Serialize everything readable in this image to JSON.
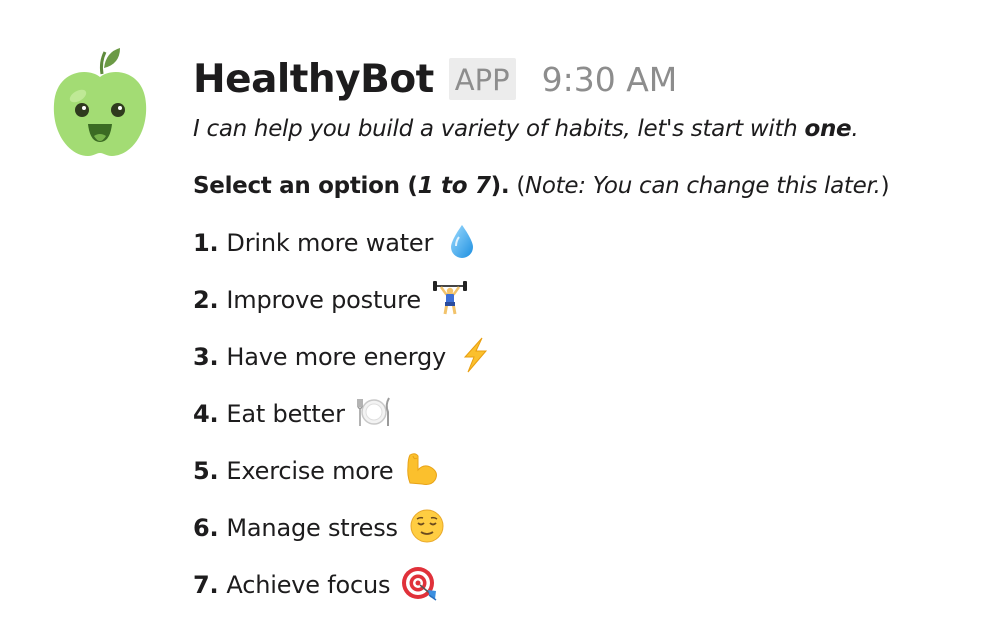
{
  "message": {
    "bot_name": "HealthyBot",
    "badge": "APP",
    "timestamp": "9:30 AM",
    "intro": {
      "before": "I can help you build a variety of habits, let's start with ",
      "bold": "one",
      "after": "."
    },
    "select": {
      "bold_a": "Select an option (",
      "bold_italic": "1 to 7",
      "bold_b": ").",
      "normal_a": " (",
      "italic": "Note: You can change this later.",
      "normal_b": ")"
    },
    "options": [
      {
        "num": "1.",
        "label": "Drink more water",
        "icon": "droplet-icon"
      },
      {
        "num": "2.",
        "label": "Improve posture",
        "icon": "weightlifter-icon"
      },
      {
        "num": "3.",
        "label": "Have more energy",
        "icon": "lightning-icon"
      },
      {
        "num": "4.",
        "label": "Eat better",
        "icon": "plate-cutlery-icon"
      },
      {
        "num": "5.",
        "label": "Exercise more",
        "icon": "flexed-bicep-icon"
      },
      {
        "num": "6.",
        "label": "Manage stress",
        "icon": "relieved-face-icon"
      },
      {
        "num": "7.",
        "label": "Achieve focus",
        "icon": "target-dart-icon"
      }
    ]
  },
  "colors": {
    "apple_green": "#a3dc74",
    "name_text": "#1d1c1d",
    "muted_text": "#8d8d8d",
    "badge_bg": "#ececec"
  }
}
